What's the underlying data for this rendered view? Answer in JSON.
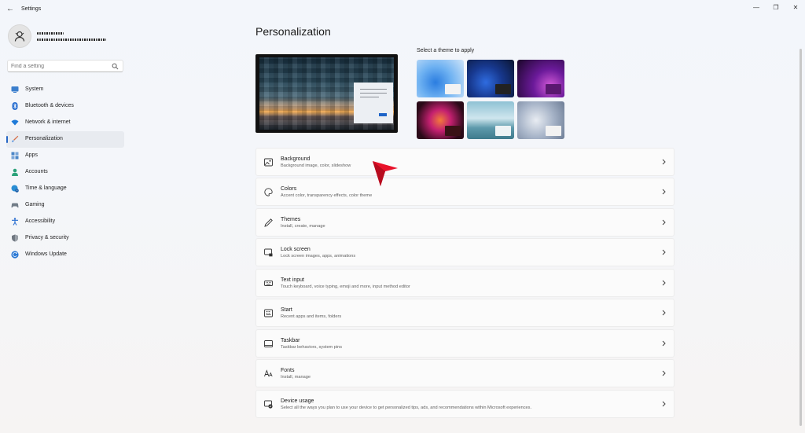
{
  "window": {
    "title": "Settings",
    "back_glyph": "←",
    "minimize_glyph": "—",
    "maximize_glyph": "❐",
    "close_glyph": "✕"
  },
  "search": {
    "placeholder": "Find a setting"
  },
  "sidebar": {
    "items": [
      {
        "label": "System",
        "icon": "monitor-icon",
        "color": "#3c7fcd"
      },
      {
        "label": "Bluetooth & devices",
        "icon": "bluetooth-icon",
        "color": "#2a6fd0"
      },
      {
        "label": "Network & internet",
        "icon": "wifi-icon",
        "color": "#1f7ad8"
      },
      {
        "label": "Personalization",
        "icon": "brush-icon",
        "color": "#d6704a",
        "active": true
      },
      {
        "label": "Apps",
        "icon": "apps-icon",
        "color": "#4a86c7"
      },
      {
        "label": "Accounts",
        "icon": "person-icon",
        "color": "#2ba27a"
      },
      {
        "label": "Time & language",
        "icon": "globe-clock-icon",
        "color": "#2a8ed4"
      },
      {
        "label": "Gaming",
        "icon": "gamepad-icon",
        "color": "#727d88"
      },
      {
        "label": "Accessibility",
        "icon": "accessibility-icon",
        "color": "#2a6fd0"
      },
      {
        "label": "Privacy & security",
        "icon": "shield-icon",
        "color": "#6f7780"
      },
      {
        "label": "Windows Update",
        "icon": "update-icon",
        "color": "#2a78d4"
      }
    ]
  },
  "main": {
    "title": "Personalization",
    "theme_label": "Select a theme to apply",
    "settings": [
      {
        "title": "Background",
        "subtitle": "Background image, color, slideshow",
        "icon": "image-icon"
      },
      {
        "title": "Colors",
        "subtitle": "Accent color, transparency effects, color theme",
        "icon": "palette-icon"
      },
      {
        "title": "Themes",
        "subtitle": "Install, create, manage",
        "icon": "pen-icon"
      },
      {
        "title": "Lock screen",
        "subtitle": "Lock screen images, apps, animations",
        "icon": "lock-screen-icon"
      },
      {
        "title": "Text input",
        "subtitle": "Touch keyboard, voice typing, emoji and more, input method editor",
        "icon": "keyboard-icon"
      },
      {
        "title": "Start",
        "subtitle": "Recent apps and items, folders",
        "icon": "start-icon"
      },
      {
        "title": "Taskbar",
        "subtitle": "Taskbar behaviors, system pins",
        "icon": "taskbar-icon"
      },
      {
        "title": "Fonts",
        "subtitle": "Install, manage",
        "icon": "fonts-icon"
      },
      {
        "title": "Device usage",
        "subtitle": "Select all the ways you plan to use your device to get personalized tips, ads, and recommendations within Microsoft experiences.",
        "icon": "device-usage-icon"
      }
    ]
  },
  "colors": {
    "accent": "#2767c5",
    "cursor": "#e8122a"
  }
}
